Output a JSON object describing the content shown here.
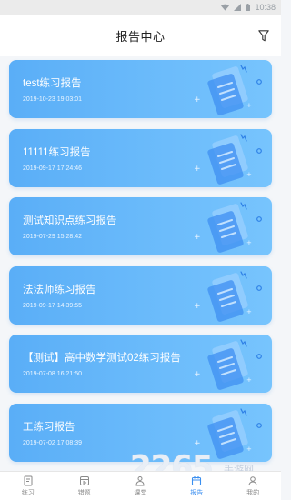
{
  "status_bar": {
    "time": "10:38"
  },
  "header": {
    "title": "报告中心"
  },
  "reports": [
    {
      "title": "test练习报告",
      "time": "2019-10-23 19:03:01"
    },
    {
      "title": "11111练习报告",
      "time": "2019-09-17 17:24:46"
    },
    {
      "title": "测试知识点练习报告",
      "time": "2019-07-29 15:28:42"
    },
    {
      "title": "法法师练习报告",
      "time": "2019-09-17 14:39:55"
    },
    {
      "title": "【测试】高中数学测试02练习报告",
      "time": "2019-07-08 16:21:50"
    },
    {
      "title": "工练习报告",
      "time": "2019-07-02 17:08:39"
    }
  ],
  "nav": [
    {
      "label": "练习",
      "icon": "practice-icon",
      "active": false
    },
    {
      "label": "错题",
      "icon": "mistakes-icon",
      "active": false
    },
    {
      "label": "课堂",
      "icon": "classroom-icon",
      "active": false
    },
    {
      "label": "报告",
      "icon": "report-icon",
      "active": true
    },
    {
      "label": "我的",
      "icon": "profile-icon",
      "active": false
    }
  ],
  "watermark": {
    "number": "2265",
    "text": "手游网",
    "url": "2265.com"
  },
  "colors": {
    "card_start": "#5aaef7",
    "card_end": "#77c4fd",
    "active_nav": "#3b8ff0"
  }
}
